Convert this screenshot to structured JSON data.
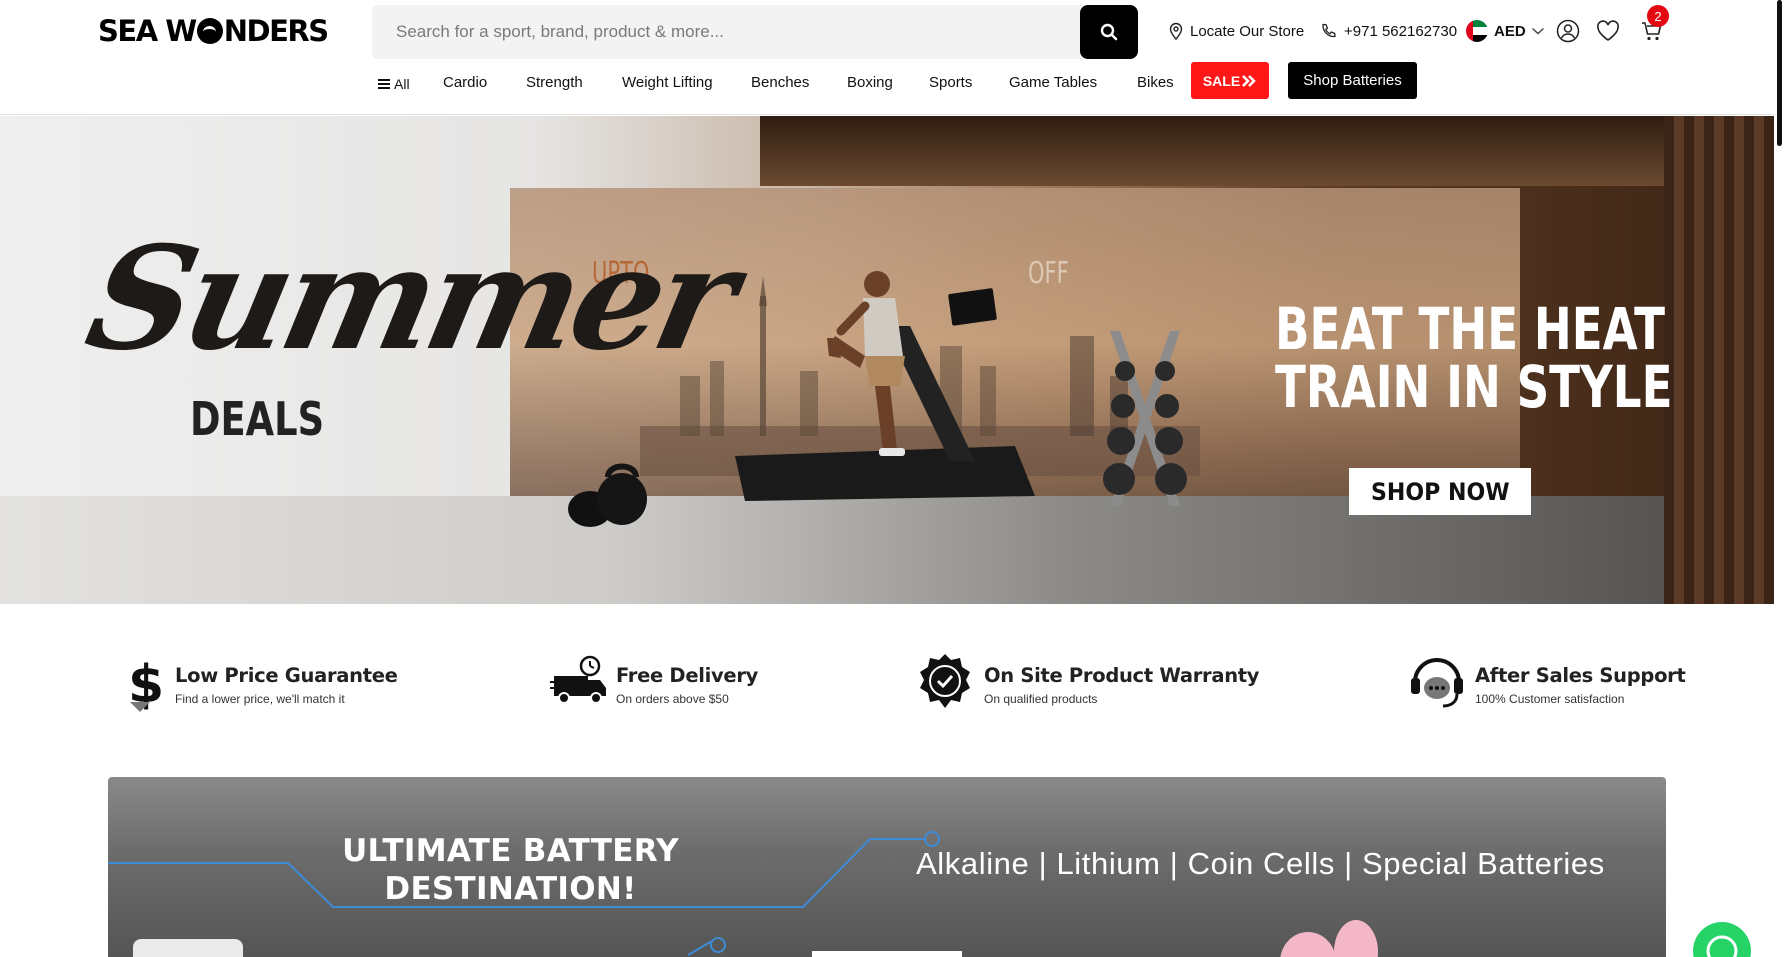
{
  "header": {
    "logo_left": "SEA W",
    "logo_right": "NDERS",
    "search_placeholder": "Search for a sport, brand, product & more...",
    "locate_store": "Locate Our Store",
    "phone": "+971 562162730",
    "currency": "AED",
    "cart_count": "2"
  },
  "nav": {
    "all_label": "All",
    "items": [
      "Cardio",
      "Strength",
      "Weight Lifting",
      "Benches",
      "Boxing",
      "Sports",
      "Game Tables",
      "Bikes"
    ],
    "sale_label": "SALE",
    "batteries_label": "Shop Batteries"
  },
  "hero": {
    "script_title": "Summer",
    "subtitle": "DEALS",
    "upto": "UPTO",
    "off": "OFF",
    "headline_line1": "BEAT THE HEAT",
    "headline_line2": "TRAIN IN STYLE",
    "cta": "SHOP NOW"
  },
  "features": [
    {
      "title": "Low Price Guarantee",
      "subtitle": "Find a lower price, we'll match it",
      "icon": "dollar-icon"
    },
    {
      "title": "Free Delivery",
      "subtitle": "On orders above $50",
      "icon": "delivery-truck-icon"
    },
    {
      "title": "On Site Product Warranty",
      "subtitle": "On qualified products",
      "icon": "warranty-badge-icon"
    },
    {
      "title": "After Sales Support",
      "subtitle": "100% Customer satisfaction",
      "icon": "support-chat-icon"
    }
  ],
  "battery_banner": {
    "title_line1": "ULTIMATE BATTERY",
    "title_line2": "DESTINATION!",
    "types": "Alkaline | Lithium | Coin Cells | Special Batteries"
  },
  "colors": {
    "sale_red": "#ff1616",
    "badge_red": "#e50914",
    "whatsapp_green": "#25d366",
    "line_blue": "#3d8bd6"
  }
}
